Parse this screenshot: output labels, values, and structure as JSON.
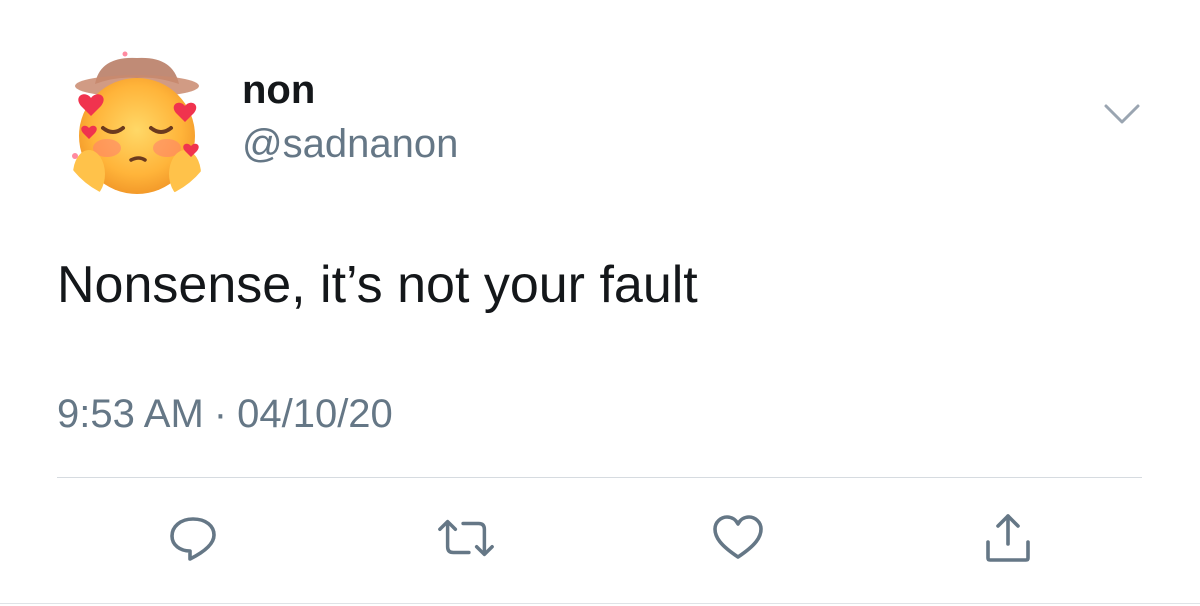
{
  "user": {
    "display_name": "non",
    "handle": "@sadnanon",
    "avatar_icon": "blushing-face-emoji-with-cowboy-hat-and-hearts"
  },
  "tweet": {
    "text": "Nonsense, it’s not your fault",
    "time": "9:53 AM",
    "separator": "·",
    "date": "04/10/20"
  },
  "actions": [
    {
      "name": "reply",
      "icon": "reply-icon"
    },
    {
      "name": "retweet",
      "icon": "retweet-icon"
    },
    {
      "name": "like",
      "icon": "heart-icon"
    },
    {
      "name": "share",
      "icon": "share-icon"
    }
  ],
  "colors": {
    "text": "#14171a",
    "secondary": "#657786",
    "icon": "#657786",
    "divider": "#d6dbe0"
  }
}
